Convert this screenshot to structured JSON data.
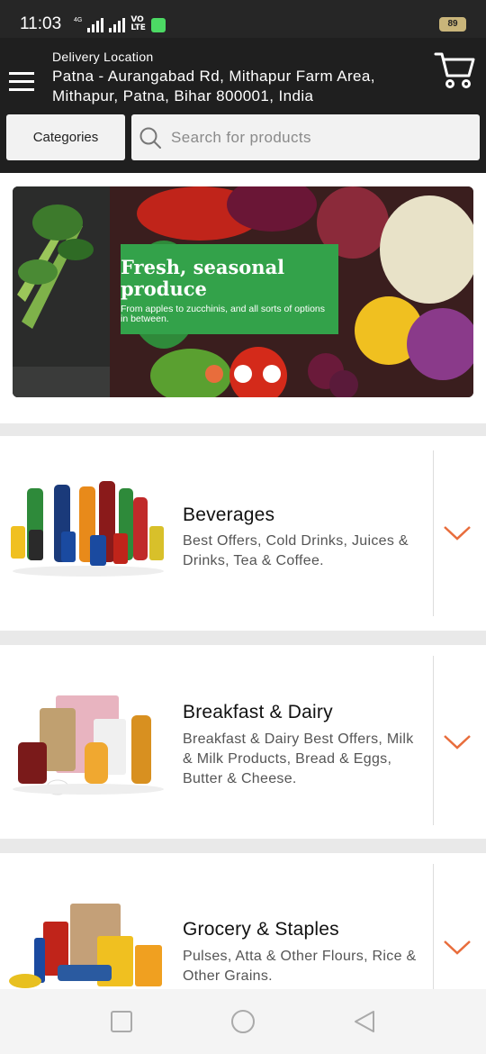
{
  "status_bar": {
    "time": "11:03",
    "network": "4G",
    "volte_line1": "VO",
    "volte_line2": "LTE",
    "battery": "89"
  },
  "header": {
    "location_label": "Delivery Location",
    "location_address": "Patna - Aurangabad Rd, Mithapur Farm Area, Mithapur, Patna, Bihar 800001, India",
    "categories_label": "Categories",
    "search_placeholder": "Search for products"
  },
  "banner": {
    "title": "Fresh, seasonal produce",
    "subtitle": "From apples to zucchinis, and all sorts of options in between.",
    "slide_count": 3,
    "active_slide": 1,
    "accent_color": "#e86d3c",
    "card_color": "#33a24a"
  },
  "categories": [
    {
      "title": "Beverages",
      "description": "Best Offers, Cold Drinks, Juices & Drinks, Tea & Coffee.",
      "icon": "chevron-down-icon"
    },
    {
      "title": "Breakfast & Dairy",
      "description": "Breakfast & Dairy Best Offers, Milk & Milk Products, Bread & Eggs, Butter & Cheese.",
      "icon": "chevron-down-icon"
    },
    {
      "title": "Grocery & Staples",
      "description": "Pulses, Atta & Other Flours, Rice & Other Grains.",
      "icon": "chevron-down-icon"
    }
  ],
  "nav_bar": {
    "buttons": [
      "recent-apps-icon",
      "home-icon",
      "back-icon"
    ]
  }
}
